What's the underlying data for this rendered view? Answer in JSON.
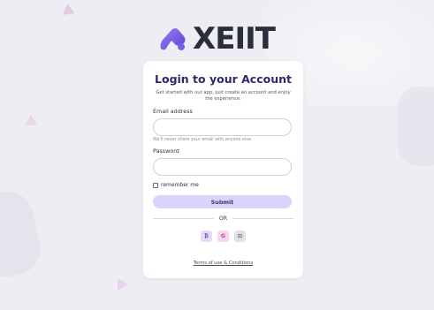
{
  "brand": {
    "name": "XEIIT",
    "accent": "#7c5cf0",
    "logo_text_color": "#2a2d3a"
  },
  "login": {
    "title": "Login to your Account",
    "subtitle": "Get started with our app, just create an account and enjoy the experience.",
    "email_label": "Email address",
    "email_value": "",
    "email_help": "We'll never share your email with anyone else.",
    "password_label": "Password",
    "password_value": "",
    "remember_label": "remember me",
    "remember_checked": false,
    "submit_label": "Submit",
    "or_label": "OR",
    "social": [
      {
        "icon": "social-icon-1",
        "glyph": "₿"
      },
      {
        "icon": "google-icon",
        "glyph": "G"
      },
      {
        "icon": "twitch-icon",
        "glyph": "⊡"
      }
    ],
    "terms_label": "Terms of use & Conditions"
  },
  "colors": {
    "submit_bg": "#d9d4fb",
    "title": "#2b2a6e",
    "page_bg": "#eeedf3"
  }
}
